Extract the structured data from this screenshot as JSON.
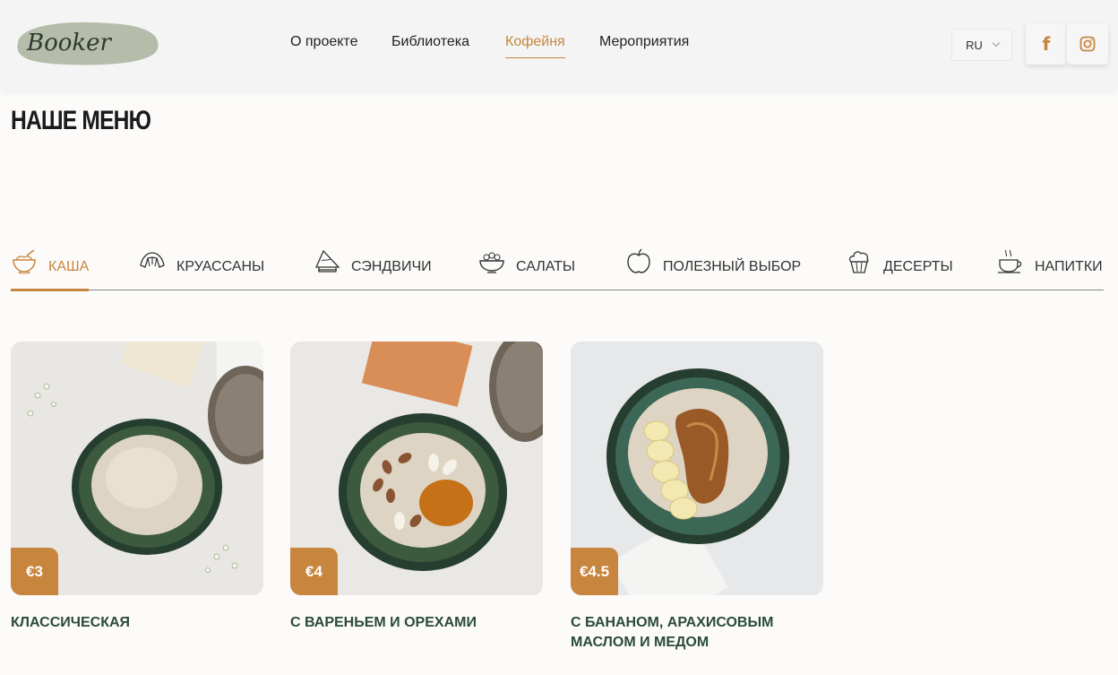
{
  "header": {
    "logo_text": "Booker",
    "nav": [
      {
        "label": "О проекте",
        "active": false
      },
      {
        "label": "Библиотека",
        "active": false
      },
      {
        "label": "Кофейня",
        "active": true
      },
      {
        "label": "Мероприятия",
        "active": false
      }
    ],
    "language": "RU",
    "social": [
      {
        "icon": "facebook-icon",
        "glyph": "f"
      },
      {
        "icon": "instagram-icon",
        "glyph": ""
      }
    ]
  },
  "page_title": "НАШЕ МЕНЮ",
  "tabs": [
    {
      "label": "КАША",
      "icon": "porridge-bowl-icon",
      "active": true
    },
    {
      "label": "КРУАССАНЫ",
      "icon": "croissant-icon",
      "active": false
    },
    {
      "label": "СЭНДВИЧИ",
      "icon": "sandwich-icon",
      "active": false
    },
    {
      "label": "САЛАТЫ",
      "icon": "salad-bowl-icon",
      "active": false
    },
    {
      "label": "ПОЛЕЗНЫЙ ВЫБОР",
      "icon": "apple-icon",
      "active": false
    },
    {
      "label": "ДЕСЕРТЫ",
      "icon": "cupcake-icon",
      "active": false
    },
    {
      "label": "НАПИТКИ",
      "icon": "coffee-cup-icon",
      "active": false
    }
  ],
  "menu_items": [
    {
      "name": "КЛАССИЧЕСКАЯ",
      "price": "€3"
    },
    {
      "name": "С ВАРЕНЬЕМ И ОРЕХАМИ",
      "price": "€4"
    },
    {
      "name": "С БАНАНОМ, АРАХИСОВЫМ МАСЛОМ И МЕДОМ",
      "price": "€4.5"
    }
  ],
  "colors": {
    "accent": "#c8853e",
    "item_name": "#2b4a3c",
    "header_bg": "#f4f4f4",
    "page_bg": "#fcfbf9"
  }
}
